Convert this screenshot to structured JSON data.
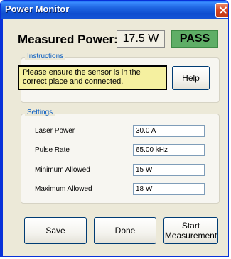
{
  "window": {
    "title": "Power Monitor"
  },
  "measured": {
    "label": "Measured Power:",
    "value": "17.5 W",
    "status": "PASS",
    "status_color": "#5fae66"
  },
  "instructions": {
    "group_label": "Instructions",
    "message": "Please ensure the sensor is in the correct place and connected.",
    "help_label": "Help"
  },
  "settings": {
    "group_label": "Settings",
    "rows": [
      {
        "label": "Laser Power",
        "value": "30.0 A"
      },
      {
        "label": "Pulse Rate",
        "value": "65.00 kHz"
      },
      {
        "label": "Minimum Allowed",
        "value": "15 W"
      },
      {
        "label": "Maximum Allowed",
        "value": "18 W"
      }
    ]
  },
  "buttons": {
    "save": "Save",
    "done": "Done",
    "start": "Start Measurement"
  },
  "icons": {
    "close": "close-icon"
  }
}
